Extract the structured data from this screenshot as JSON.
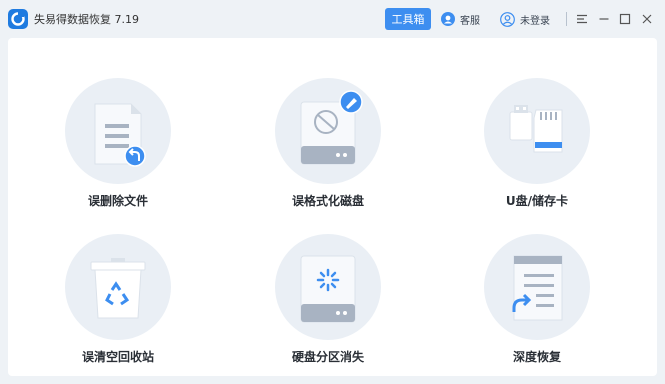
{
  "app": {
    "title": "失易得数据恢复 7.19",
    "logo": "app-logo-icon"
  },
  "toolbar": {
    "toolbox_label": "工具箱",
    "service_label": "客服",
    "login_label": "未登录",
    "accent": "#3d8ef0"
  },
  "cards": [
    {
      "label": "误删除文件",
      "icon": "deleted-file-icon"
    },
    {
      "label": "误格式化磁盘",
      "icon": "formatted-disk-icon"
    },
    {
      "label": "U盘/储存卡",
      "icon": "usb-sdcard-icon"
    },
    {
      "label": "误清空回收站",
      "icon": "recycle-bin-icon"
    },
    {
      "label": "硬盘分区消失",
      "icon": "lost-partition-icon"
    },
    {
      "label": "深度恢复",
      "icon": "deep-recovery-icon"
    }
  ]
}
